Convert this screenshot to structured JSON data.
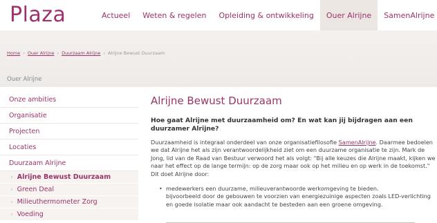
{
  "header": {
    "logo": "Plaza",
    "nav": [
      {
        "label": "Actueel"
      },
      {
        "label": "Weten & regelen"
      },
      {
        "label": "Opleiding & ontwikkeling"
      },
      {
        "label": "Ouer Alrijne",
        "active": true
      },
      {
        "label": "SamenAlrijne"
      }
    ]
  },
  "breadcrumb": [
    "Home",
    "Ouer Alrijne",
    "Duurzaam Alrijne",
    "Alrijne Bewust Duurzaam"
  ],
  "section_label": "Ouer Alrijne",
  "sidebar": {
    "items": [
      {
        "label": "Onze ambities"
      },
      {
        "label": "Organisatie"
      },
      {
        "label": "Projecten"
      },
      {
        "label": "Locaties"
      },
      {
        "label": "Duurzaam Alrijne"
      }
    ],
    "subitems": [
      {
        "label": "Alrijne Bewust Duurzaam",
        "current": true
      },
      {
        "label": "Green Deal"
      },
      {
        "label": "Milieuthermometer Zorg"
      },
      {
        "label": "Voeding"
      }
    ],
    "chevron": "›"
  },
  "main": {
    "title": "Alrijne Bewust Duurzaam",
    "lead": "Hoe gaat Alrijne met duurzaamheid om? En wat kan jij bijdragen aan een duurzamer Alrijne?",
    "body_before_link": "Duurzaamheid is integraal onderdeel van onze organisatiefilosofie ",
    "body_link": "SamenAlrijne",
    "body_after_link": ". Daarmee bedoelen we dat Alrijne het als zijn verantwoordelijkheid ziet om een duurzame organisatie te zijn. Mark de Jong, lid van de Raad van Bestuur verwoord het als volgt: \"Bij alle keuzes die Alrijne maakt, kijken we naar het effect op de lange termijn: op de zorg maar ook op het milieu en op werk in de toekomst.\" Dit doet Alrijne door:",
    "bullet_1": "medewerkers een duurzame, milieuverantwoorde werkomgeving te bieden.",
    "bullet_1_cont": "bijvoorbeeld door de gebouwen te voorzien van energiezuinige aspecten zoals LED-verlichting en goede isolatie maar ook aandacht te besteden aan een groene omgeving.",
    "bullet_dot": "•"
  },
  "colors": {
    "brand": "#9a3468",
    "logo": "#a0306c",
    "band": "#f0ece9",
    "nav_active_bg": "#ebe6e2"
  }
}
